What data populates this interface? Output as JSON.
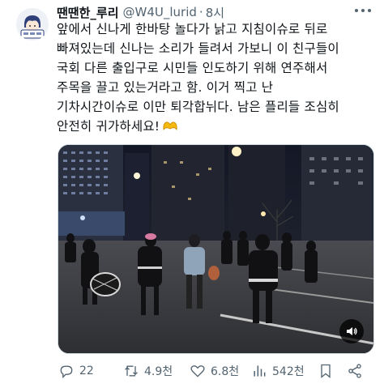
{
  "tweet": {
    "display_name": "땐땐한_루리",
    "handle": "@W4U_lurid",
    "separator": "·",
    "time": "8시",
    "lines": [
      "앞에서 신나게 한바탕 놀다가 낡고 지침이슈로 뒤로",
      "빠져있는데 신나는 소리가 들려서 가보니 이 친구들이",
      "국회 다른 출입구로 시민들 인도하기 위해 연주해서",
      "주목을 끌고 있는거라고 함. 이거 찍고 난",
      "기차시간이슈로 이만 퇴각합뉘다. 남은 플리들 조심히",
      "안전히 귀가하세요!"
    ],
    "emoji_icon": "heart-hands-emoji"
  },
  "media": {
    "type": "video",
    "sound_icon": "volume-icon"
  },
  "actions": {
    "reply_count": "22",
    "retweet_count": "4.9천",
    "like_count": "6.8천",
    "view_count": "542천"
  },
  "colors": {
    "text": "#0f1419",
    "secondary": "#536471",
    "border": "#cfd9de",
    "emoji": "#f5b90f"
  }
}
